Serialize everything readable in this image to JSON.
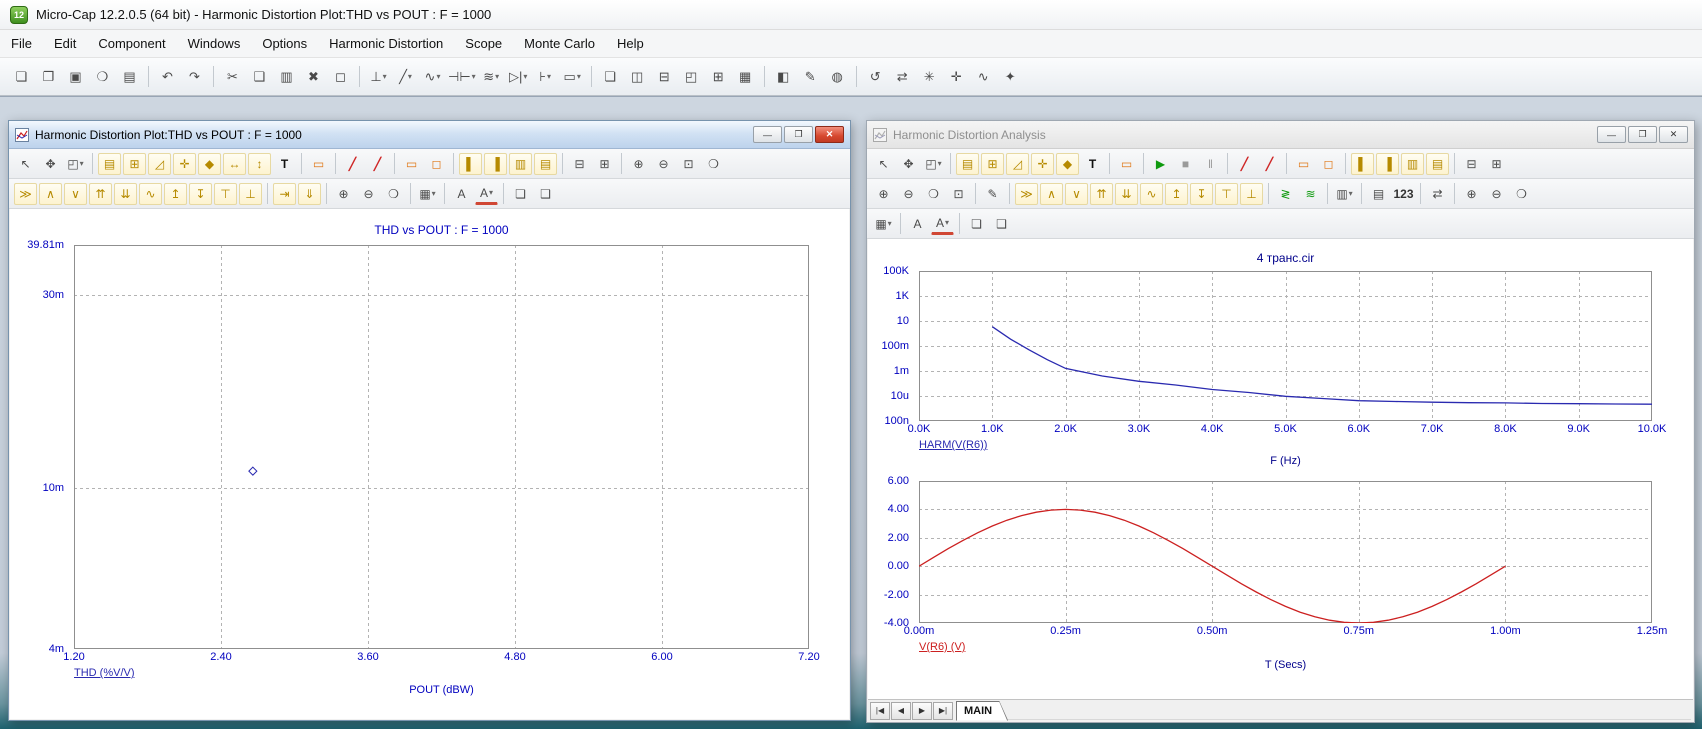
{
  "colors": {
    "series_blue": "#2a2ab0",
    "series_red": "#cc2020",
    "axis_text": "#0000bf",
    "analysis_title": "#00008b",
    "run_green": "#0f9a0f",
    "close_button_red": "#c23a22",
    "titlebar_active": "#bdd3ec",
    "titlebar_inactive_text": "#8f8f8f"
  },
  "glyphs": {
    "minimize": "—",
    "maximize": "❐",
    "close": "✕"
  },
  "app": {
    "icon": "12",
    "title": "Micro-Cap 12.2.0.5 (64 bit) - Harmonic Distortion Plot:THD vs POUT : F = 1000",
    "menu": [
      "File",
      "Edit",
      "Component",
      "Windows",
      "Options",
      "Harmonic Distortion",
      "Scope",
      "Monte Carlo",
      "Help"
    ]
  },
  "toolbar_main": [
    [
      [
        "new-file",
        "❏"
      ],
      [
        "open-file",
        "❐"
      ],
      [
        "save-file",
        "▣"
      ],
      [
        "find",
        "❍"
      ],
      [
        "print",
        "▤"
      ]
    ],
    [
      [
        "undo",
        "↶"
      ],
      [
        "redo",
        "↷"
      ]
    ],
    [
      [
        "cut",
        "✂"
      ],
      [
        "copy",
        "❑"
      ],
      [
        "paste",
        "▥"
      ],
      [
        "delete",
        "✖"
      ],
      [
        "select-region",
        "◻"
      ]
    ],
    [
      [
        "ground-component",
        "⊥",
        "dd"
      ],
      [
        "wire-mode",
        "╱",
        "dd"
      ],
      [
        "sine-source",
        "∿",
        "dd"
      ],
      [
        "capacitor",
        "⊣⊢",
        "dd"
      ],
      [
        "inductor",
        "≋",
        "dd"
      ],
      [
        "diode",
        "▷|",
        "dd"
      ],
      [
        "transistor",
        "⊦",
        "dd"
      ],
      [
        "macro-block",
        "▭",
        "dd"
      ]
    ],
    [
      [
        "cascade-windows",
        "❏"
      ],
      [
        "tile-vertical",
        "◫"
      ],
      [
        "tile-horizontal",
        "⊟"
      ],
      [
        "split-window",
        "◰"
      ],
      [
        "arrange-icons",
        "⊞"
      ],
      [
        "calculator",
        "▦"
      ]
    ],
    [
      [
        "component-panel",
        "◧"
      ],
      [
        "shape-editor",
        "✎"
      ],
      [
        "globe-browser",
        "◍"
      ]
    ],
    [
      [
        "refresh-models",
        "↺"
      ],
      [
        "dynamic-dc",
        "⇄"
      ],
      [
        "settings",
        "✳"
      ],
      [
        "probe-mode",
        "✛"
      ],
      [
        "analysis-plot",
        "∿"
      ],
      [
        "optimizer",
        "✦"
      ]
    ]
  ],
  "left_window": {
    "title": "Harmonic Distortion Plot:THD vs POUT : F = 1000",
    "toolbar1": [
      [
        [
          "select-mode",
          "↖"
        ],
        [
          "pan-mode",
          "✥"
        ],
        [
          "zoom-mode",
          "◰",
          "dd"
        ]
      ],
      [
        [
          "properties",
          "▤",
          "y"
        ],
        [
          "add-scale",
          "⊞",
          "y"
        ],
        [
          "scale-mode",
          "◿",
          "y"
        ],
        [
          "cursor-mode",
          "✛",
          "y"
        ],
        [
          "point-tag",
          "◆",
          "y"
        ],
        [
          "horizontal-tag",
          "↔",
          "y"
        ],
        [
          "vertical-tag",
          "↕",
          "y"
        ],
        [
          "text-mode",
          "T",
          "bold"
        ]
      ],
      [
        [
          "waveform-buffer",
          "▭",
          "o"
        ]
      ],
      [
        [
          "probe-red-1",
          "╱",
          "r"
        ],
        [
          "probe-red-2",
          "╱",
          "r"
        ]
      ],
      [
        [
          "performance-windows",
          "▭",
          "o"
        ],
        [
          "slideshow",
          "◻",
          "o"
        ]
      ],
      [
        [
          "panel-left",
          "▌",
          "y"
        ],
        [
          "panel-right",
          "▐",
          "y"
        ],
        [
          "tile-plots-vertical",
          "▥",
          "y"
        ],
        [
          "tile-plots-horizontal",
          "▤",
          "y"
        ]
      ],
      [
        [
          "split-horizontal",
          "⊟"
        ],
        [
          "split-vertical",
          "⊞"
        ]
      ],
      [
        [
          "zoom-in",
          "⊕"
        ],
        [
          "zoom-out",
          "⊖"
        ],
        [
          "zoom-area",
          "⊡"
        ],
        [
          "zoom-fit",
          "❍"
        ]
      ]
    ],
    "toolbar2": [
      [
        [
          "next-point",
          "≫",
          "y"
        ],
        [
          "peak",
          "∧",
          "y"
        ],
        [
          "valley",
          "∨",
          "y"
        ],
        [
          "high",
          "⇈",
          "y"
        ],
        [
          "low",
          "⇊",
          "y"
        ],
        [
          "inflection",
          "∿",
          "y"
        ],
        [
          "global-high",
          "↥",
          "y"
        ],
        [
          "global-low",
          "↧",
          "y"
        ],
        [
          "top",
          "⊤",
          "y"
        ],
        [
          "bottom",
          "⊥",
          "y"
        ]
      ],
      [
        [
          "go-to-x",
          "⇥",
          "y"
        ],
        [
          "go-to-y",
          "⇓",
          "y"
        ]
      ],
      [
        [
          "zoom-in",
          "⊕"
        ],
        [
          "zoom-out",
          "⊖"
        ],
        [
          "zoom-auto",
          "❍"
        ]
      ],
      [
        [
          "grid-options",
          "▦",
          "dd"
        ]
      ],
      [
        [
          "font",
          "A"
        ],
        [
          "font-color",
          "A",
          "dd clr"
        ]
      ],
      [
        [
          "copy-graph",
          "❏"
        ],
        [
          "copy-window",
          "❑"
        ]
      ]
    ]
  },
  "right_window": {
    "title": "Harmonic Distortion Analysis",
    "tab": "MAIN",
    "nav_buttons": [
      [
        "first",
        "|◀"
      ],
      [
        "previous",
        "◀"
      ],
      [
        "next",
        "▶"
      ],
      [
        "last",
        "▶|"
      ]
    ],
    "toolbar1": [
      [
        [
          "select-mode",
          "↖"
        ],
        [
          "pan-mode",
          "✥"
        ],
        [
          "zoom-mode",
          "◰",
          "dd"
        ]
      ],
      [
        [
          "properties",
          "▤",
          "y"
        ],
        [
          "add-scale",
          "⊞",
          "y"
        ],
        [
          "scale-mode",
          "◿",
          "y"
        ],
        [
          "cursor-mode",
          "✛",
          "y"
        ],
        [
          "point-tag",
          "◆",
          "y"
        ],
        [
          "text-mode",
          "T",
          "bold"
        ]
      ],
      [
        [
          "waveform-buffer",
          "▭",
          "o"
        ]
      ],
      [
        [
          "run",
          "▶",
          "g"
        ],
        [
          "stop",
          "■",
          "dim"
        ],
        [
          "pause",
          "‖",
          "dim"
        ]
      ],
      [
        [
          "probe-red-1",
          "╱",
          "r"
        ],
        [
          "probe-red-2",
          "╱",
          "r"
        ]
      ],
      [
        [
          "performance-windows",
          "▭",
          "o"
        ],
        [
          "slideshow",
          "◻",
          "o"
        ]
      ],
      [
        [
          "panel-left",
          "▌",
          "y"
        ],
        [
          "panel-right",
          "▐",
          "y"
        ],
        [
          "tile-plots-vertical",
          "▥",
          "y"
        ],
        [
          "tile-plots-horizontal",
          "▤",
          "y"
        ]
      ],
      [
        [
          "split-horizontal",
          "⊟"
        ],
        [
          "split-vertical",
          "⊞"
        ]
      ]
    ],
    "toolbar2": [
      [
        [
          "zoom-in",
          "⊕"
        ],
        [
          "zoom-out",
          "⊖"
        ],
        [
          "zoom-auto",
          "❍"
        ],
        [
          "zoom-area",
          "⊡"
        ]
      ],
      [
        [
          "edit-waveform",
          "✎"
        ]
      ],
      [
        [
          "next-point",
          "≫",
          "y"
        ],
        [
          "peak",
          "∧",
          "y"
        ],
        [
          "valley",
          "∨",
          "y"
        ],
        [
          "high",
          "⇈",
          "y"
        ],
        [
          "low",
          "⇊",
          "y"
        ],
        [
          "inflection",
          "∿",
          "y"
        ],
        [
          "global-high",
          "↥",
          "y"
        ],
        [
          "global-low",
          "↧",
          "y"
        ],
        [
          "top",
          "⊤",
          "y"
        ],
        [
          "bottom",
          "⊥",
          "y"
        ]
      ],
      [
        [
          "stepping",
          "≷",
          "g"
        ],
        [
          "waveform-order",
          "≋",
          "g"
        ]
      ],
      [
        [
          "paste-waveform",
          "▥",
          "dd"
        ]
      ],
      [
        [
          "numeric-output",
          "▤"
        ],
        [
          "data-points",
          "123",
          "num"
        ]
      ],
      [
        [
          "normalize",
          "⇄"
        ]
      ],
      [
        [
          "zoom-in-2",
          "⊕"
        ],
        [
          "zoom-out-2",
          "⊖"
        ],
        [
          "zoom-full",
          "❍"
        ]
      ]
    ],
    "toolbar3": [
      [
        [
          "grid-options",
          "▦",
          "dd"
        ]
      ],
      [
        [
          "font",
          "A"
        ],
        [
          "font-color",
          "A",
          "dd clr"
        ]
      ],
      [
        [
          "copy-graph",
          "❏"
        ],
        [
          "copy-window",
          "❑"
        ]
      ]
    ]
  },
  "chart_data": [
    {
      "type": "scatter",
      "title": "THD vs POUT : F = 1000",
      "legend": "THD (%V/V)",
      "xlabel": "POUT (dBW)",
      "x_ticks": [
        "1.20",
        "2.40",
        "3.60",
        "4.80",
        "6.00",
        "7.20"
      ],
      "xlim": [
        1.2,
        7.2
      ],
      "y_ticks": [
        {
          "label": "39.81m",
          "value": 0.03981
        },
        {
          "label": "30m",
          "value": 0.03
        },
        {
          "label": "10m",
          "value": 0.01
        },
        {
          "label": "4m",
          "value": 0.004
        }
      ],
      "yscale": "log",
      "ylim": [
        0.004,
        0.03981
      ],
      "points": [
        {
          "x": 2.66,
          "y": 0.011
        }
      ],
      "color": "#2a2ab0",
      "grid": "dashed",
      "legend_position": "bottom-left"
    },
    {
      "type": "line",
      "title": "4 транс.cir",
      "legend": "HARM(V(R6))",
      "xlabel": "F (Hz)",
      "x_ticks": [
        "0.0K",
        "1.0K",
        "2.0K",
        "3.0K",
        "4.0K",
        "5.0K",
        "6.0K",
        "7.0K",
        "8.0K",
        "9.0K",
        "10.0K"
      ],
      "xlim": [
        0,
        10000
      ],
      "y_ticks": [
        {
          "label": "100K",
          "value": 100000
        },
        {
          "label": "1K",
          "value": 1000
        },
        {
          "label": "10",
          "value": 10
        },
        {
          "label": "100m",
          "value": 0.1
        },
        {
          "label": "1m",
          "value": 0.001
        },
        {
          "label": "10u",
          "value": 1e-05
        },
        {
          "label": "100n",
          "value": 1e-07
        }
      ],
      "yscale": "log",
      "ylim": [
        1e-07,
        100000
      ],
      "x": [
        1000,
        1250,
        1500,
        1750,
        2000,
        2500,
        3000,
        3500,
        4000,
        4500,
        5000,
        5500,
        6000,
        6500,
        7000,
        7500,
        8000,
        8500,
        9000,
        9500,
        10000
      ],
      "y": [
        3.5,
        0.35,
        0.05,
        0.008,
        0.0016,
        0.0004,
        0.00015,
        7.6e-05,
        3.3e-05,
        1.9e-05,
        9.5e-06,
        6.3e-06,
        4.2e-06,
        3.6e-06,
        3.2e-06,
        2.9e-06,
        2.8e-06,
        2.5e-06,
        2.4e-06,
        2.3e-06,
        2.2e-06
      ],
      "color": "#2a2ab0",
      "grid": "dashed"
    },
    {
      "type": "line",
      "title": "",
      "legend": "V(R6) (V)",
      "xlabel": "T (Secs)",
      "x_ticks": [
        "0.00m",
        "0.25m",
        "0.50m",
        "0.75m",
        "1.00m",
        "1.25m"
      ],
      "xlim": [
        0,
        1.25
      ],
      "y_ticks": [
        {
          "label": "6.00",
          "value": 6
        },
        {
          "label": "4.00",
          "value": 4
        },
        {
          "label": "2.00",
          "value": 2
        },
        {
          "label": "0.00",
          "value": 0
        },
        {
          "label": "-2.00",
          "value": -2
        },
        {
          "label": "-4.00",
          "value": -4
        }
      ],
      "yscale": "linear",
      "ylim": [
        -4,
        6
      ],
      "x": [
        0,
        0.025,
        0.05,
        0.075,
        0.1,
        0.125,
        0.15,
        0.175,
        0.2,
        0.225,
        0.25,
        0.275,
        0.3,
        0.325,
        0.35,
        0.375,
        0.4,
        0.425,
        0.45,
        0.475,
        0.5,
        0.525,
        0.55,
        0.575,
        0.6,
        0.625,
        0.65,
        0.675,
        0.7,
        0.725,
        0.75,
        0.775,
        0.8,
        0.825,
        0.85,
        0.875,
        0.9,
        0.925,
        0.95,
        0.975,
        1.0
      ],
      "y": [
        0,
        0.626,
        1.236,
        1.816,
        2.351,
        2.828,
        3.236,
        3.564,
        3.804,
        3.951,
        4,
        3.951,
        3.804,
        3.564,
        3.236,
        2.828,
        2.351,
        1.816,
        1.236,
        0.626,
        0,
        -0.626,
        -1.236,
        -1.816,
        -2.351,
        -2.828,
        -3.236,
        -3.564,
        -3.804,
        -3.951,
        -4,
        -3.951,
        -3.804,
        -3.564,
        -3.236,
        -2.828,
        -2.351,
        -1.816,
        -1.236,
        -0.626,
        0
      ],
      "color": "#cc2020",
      "grid": "dashed"
    }
  ]
}
